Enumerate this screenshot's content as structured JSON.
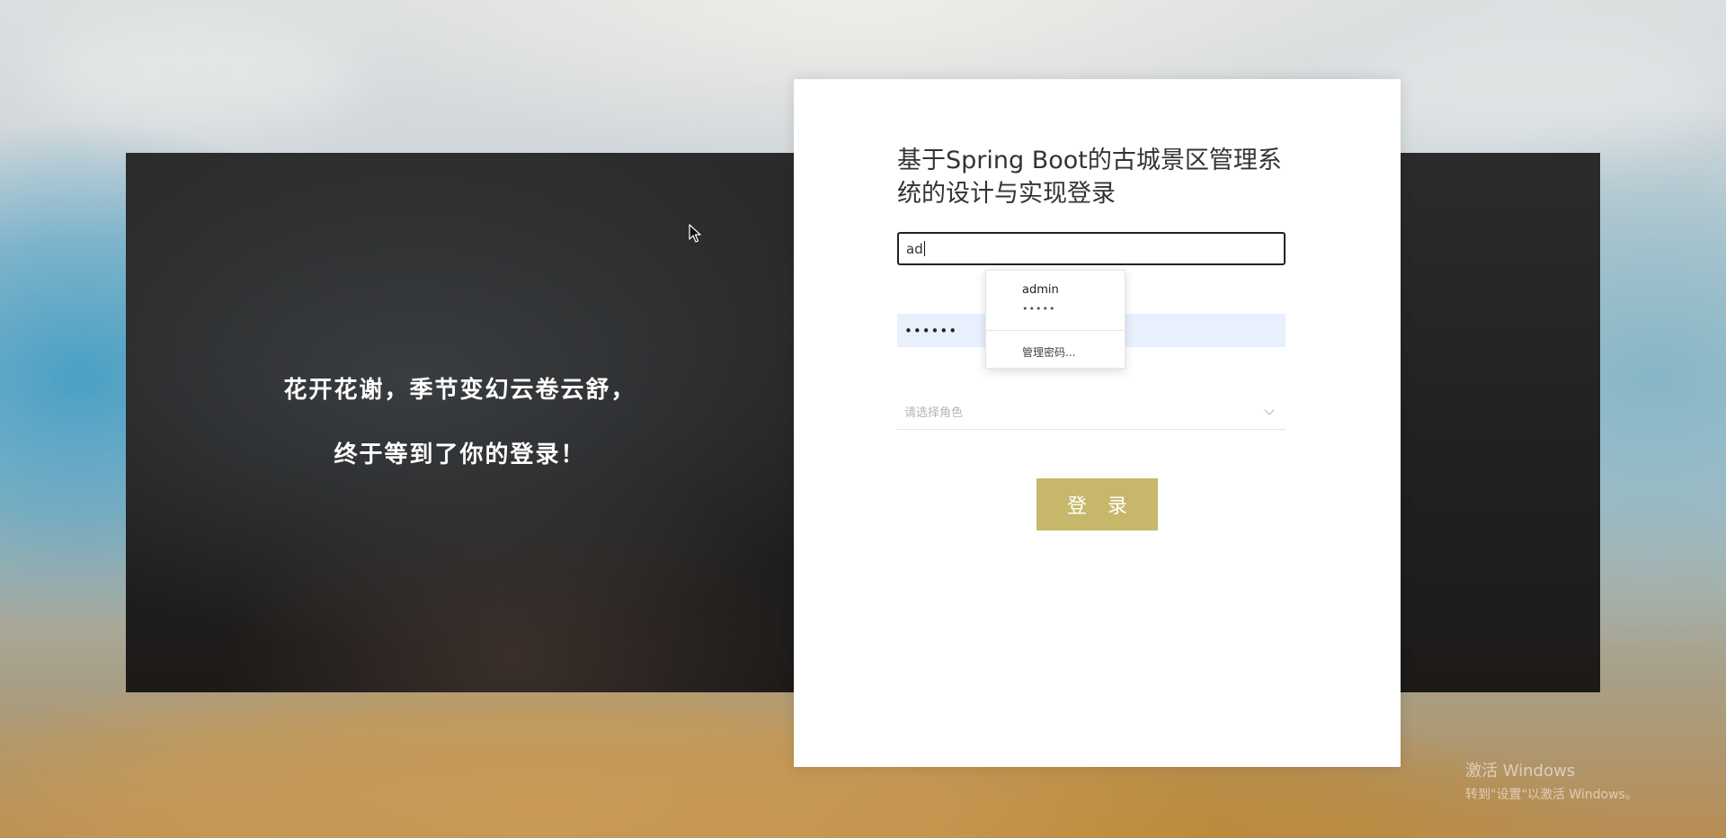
{
  "quote": {
    "line1": "花开花谢，季节变幻云卷云舒，",
    "line2": "终于等到了你的登录！"
  },
  "login": {
    "title": "基于Spring Boot的古城景区管理系统的设计与实现登录",
    "username_value": "ad",
    "password_value": "••••••",
    "role_placeholder": "请选择角色",
    "submit_label": "登 录"
  },
  "autocomplete": {
    "username": "admin",
    "password_mask": "•••••",
    "manage_label": "管理密码..."
  },
  "watermark": {
    "line1": "激活 Windows",
    "line2": "转到\"设置\"以激活 Windows。"
  },
  "colors": {
    "button": "#c7b76b",
    "autofill": "#e8f0fe"
  }
}
